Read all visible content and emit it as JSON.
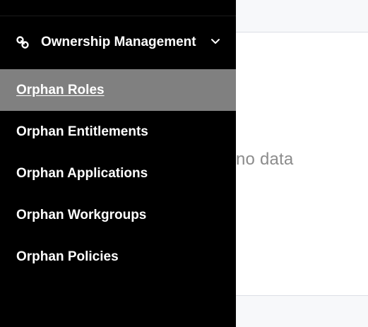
{
  "sidebar": {
    "group": {
      "icon": "link-icon",
      "label": "Ownership Management",
      "expanded": true,
      "chevron_icon": "chevron-down-icon"
    },
    "items": [
      {
        "label": "Orphan Roles",
        "active": true
      },
      {
        "label": "Orphan Entitlements",
        "active": false
      },
      {
        "label": "Orphan Applications",
        "active": false
      },
      {
        "label": "Orphan Workgroups",
        "active": false
      },
      {
        "label": "Orphan Policies",
        "active": false
      }
    ]
  },
  "content": {
    "empty_text": "no data"
  },
  "colors": {
    "sidebar_bg": "#000000",
    "active_item_bg": "#808080",
    "text": "#ffffff",
    "empty_text": "#8c8c8c"
  }
}
